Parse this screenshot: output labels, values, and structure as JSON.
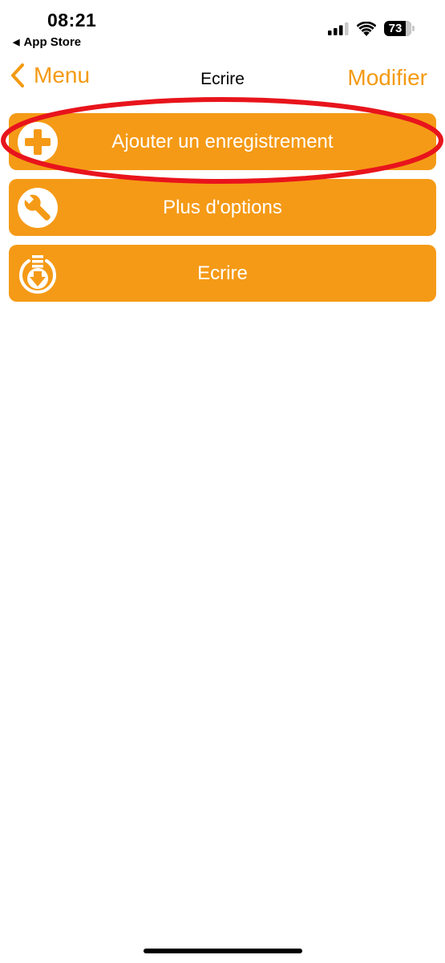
{
  "status_bar": {
    "time": "08:21",
    "back_app_label": "App Store",
    "battery_level": "73"
  },
  "nav": {
    "back_label": "Menu",
    "title": "Ecrire",
    "edit_label": "Modifier"
  },
  "actions": [
    {
      "label": "Ajouter un enregistrement",
      "icon": "plus-circle-icon"
    },
    {
      "label": "Plus d'options",
      "icon": "wrench-icon"
    },
    {
      "label": "Ecrire",
      "icon": "download-arrow-icon"
    }
  ],
  "colors": {
    "accent": "#f49a12",
    "button_background": "#f59a16",
    "highlight_annotation": "#e8141c"
  }
}
